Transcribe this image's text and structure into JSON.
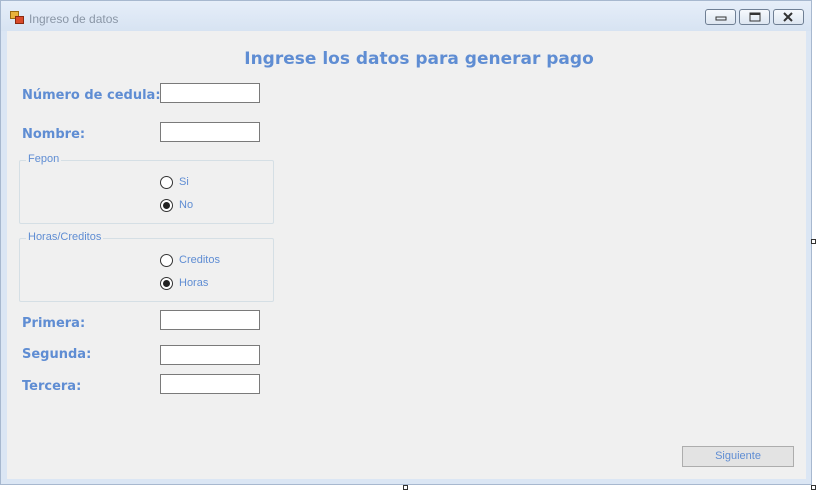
{
  "window": {
    "title": "Ingreso de datos"
  },
  "form": {
    "heading": "Ingrese los datos para generar pago",
    "cedula_label": "Número de cedula:",
    "cedula_value": "",
    "nombre_label": "Nombre:",
    "nombre_value": "",
    "fepon": {
      "title": "Fepon",
      "options": [
        {
          "label": "Si",
          "checked": false
        },
        {
          "label": "No",
          "checked": true
        }
      ]
    },
    "horas_creditos": {
      "title": "Horas/Creditos",
      "options": [
        {
          "label": "Creditos",
          "checked": false
        },
        {
          "label": "Horas",
          "checked": true
        }
      ]
    },
    "primera_label": "Primera:",
    "primera_value": "",
    "segunda_label": "Segunda:",
    "segunda_value": "",
    "tercera_label": "Tercera:",
    "tercera_value": "",
    "next_button": "Siguiente"
  },
  "colors": {
    "label": "#5f8dd3",
    "client_bg": "#f0f0f0",
    "frame": "#dbe6f4"
  },
  "icons": [
    "app-icon",
    "minimize-icon",
    "maximize-icon",
    "close-icon"
  ]
}
